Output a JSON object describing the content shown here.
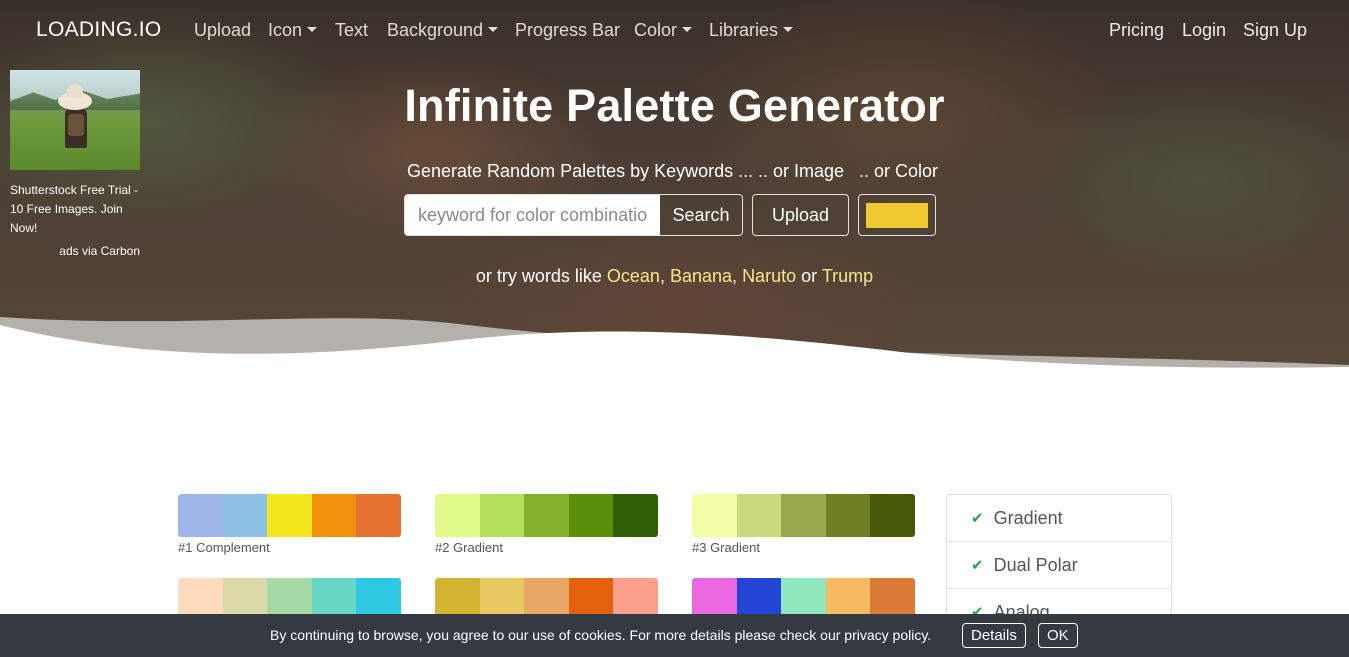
{
  "nav": {
    "brand": "LOADING.IO",
    "items": [
      {
        "label": "Upload",
        "dropdown": false
      },
      {
        "label": "Icon",
        "dropdown": true
      },
      {
        "label": "Text",
        "dropdown": false
      },
      {
        "label": "Background",
        "dropdown": true
      },
      {
        "label": "Progress Bar",
        "dropdown": false
      },
      {
        "label": "Color",
        "dropdown": true
      },
      {
        "label": "Libraries",
        "dropdown": true
      }
    ],
    "right": [
      "Pricing",
      "Login",
      "Sign Up"
    ]
  },
  "ad": {
    "text": "Shutterstock Free Trial - 10 Free Images. Join Now!",
    "via": "ads via Carbon"
  },
  "hero": {
    "title": "Infinite Palette Generator",
    "sub_keywords": "Generate Random Palettes by Keywords ...",
    "sub_image": ".. or Image",
    "sub_color": ".. or Color",
    "search_placeholder": "keyword for color combination",
    "search_button": "Search",
    "upload_button": "Upload",
    "picked_color": "#efc932",
    "try_prefix": "or try words like",
    "try_words": [
      "Ocean",
      "Banana",
      "Naruto",
      "Trump"
    ],
    "try_sep": ",",
    "try_or": "or",
    "try_word_color": "#f5e88a"
  },
  "palettes": [
    {
      "label": "#1 Complement",
      "colors": [
        "#9fb6e8",
        "#8ec1e6",
        "#f4e61d",
        "#f0920b",
        "#e57231"
      ]
    },
    {
      "label": "#2 Gradient",
      "colors": [
        "#e0fb8b",
        "#b2df5c",
        "#84b12d",
        "#5b8e0a",
        "#2e5e05"
      ]
    },
    {
      "label": "#3 Gradient",
      "colors": [
        "#f3fea8",
        "#c9d97e",
        "#98a84c",
        "#6e7f25",
        "#465908"
      ]
    },
    {
      "label": "",
      "colors": [
        "#fedbbd",
        "#dbd9a7",
        "#a5d9a6",
        "#67d6c2",
        "#2fc8e3"
      ]
    },
    {
      "label": "",
      "colors": [
        "#d2b632",
        "#e7c862",
        "#e9a767",
        "#e3620e",
        "#fda18c"
      ]
    },
    {
      "label": "",
      "colors": [
        "#ec68e2",
        "#2245d6",
        "#8ee7bd",
        "#f5ba62",
        "#d97b36"
      ]
    }
  ],
  "side_list": [
    "Gradient",
    "Dual Polar",
    "Analog"
  ],
  "cookie": {
    "text": "By continuing to browse, you agree to our use of cookies. For more details please check our privacy policy.",
    "details": "Details",
    "ok": "OK"
  }
}
